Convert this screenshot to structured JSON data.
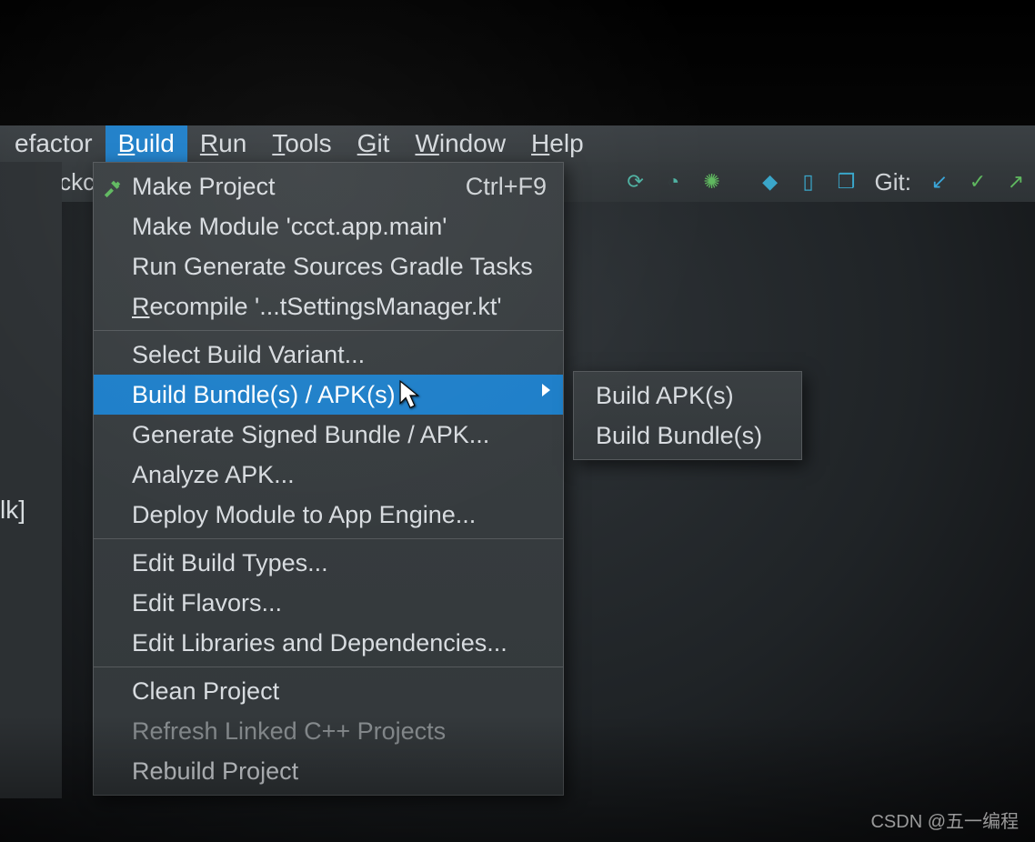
{
  "menubar": {
    "refactor": "efactor",
    "build": "Build",
    "run": "Run",
    "tools": "Tools",
    "git": "Git",
    "window": "Window",
    "help": "Help"
  },
  "toolrow": {
    "tab": "rockch",
    "git_label": "Git:"
  },
  "left_label": "lk]",
  "build_menu": {
    "make_project": "Make Project",
    "make_project_sc": "Ctrl+F9",
    "make_module": "Make Module 'ccct.app.main'",
    "run_gen": "Run Generate Sources Gradle Tasks",
    "recompile_pre": "R",
    "recompile_rest": "ecompile '...tSettingsManager.kt'",
    "select_variant": "Select Build Variant...",
    "build_bundles": "Build Bundle(s) / APK(s)",
    "gen_signed": "Generate Signed Bundle / APK...",
    "analyze": "Analyze APK...",
    "deploy": "Deploy Module to App Engine...",
    "edit_types": "Edit Build Types...",
    "edit_flavors": "Edit Flavors...",
    "edit_libs": "Edit Libraries and Dependencies...",
    "clean": "Clean Project",
    "refresh_cpp": "Refresh Linked C++ Projects",
    "rebuild": "Rebuild Project"
  },
  "submenu": {
    "build_apk": "Build APK(s)",
    "build_bundle": "Build Bundle(s)"
  },
  "watermark": "CSDN @五一编程"
}
